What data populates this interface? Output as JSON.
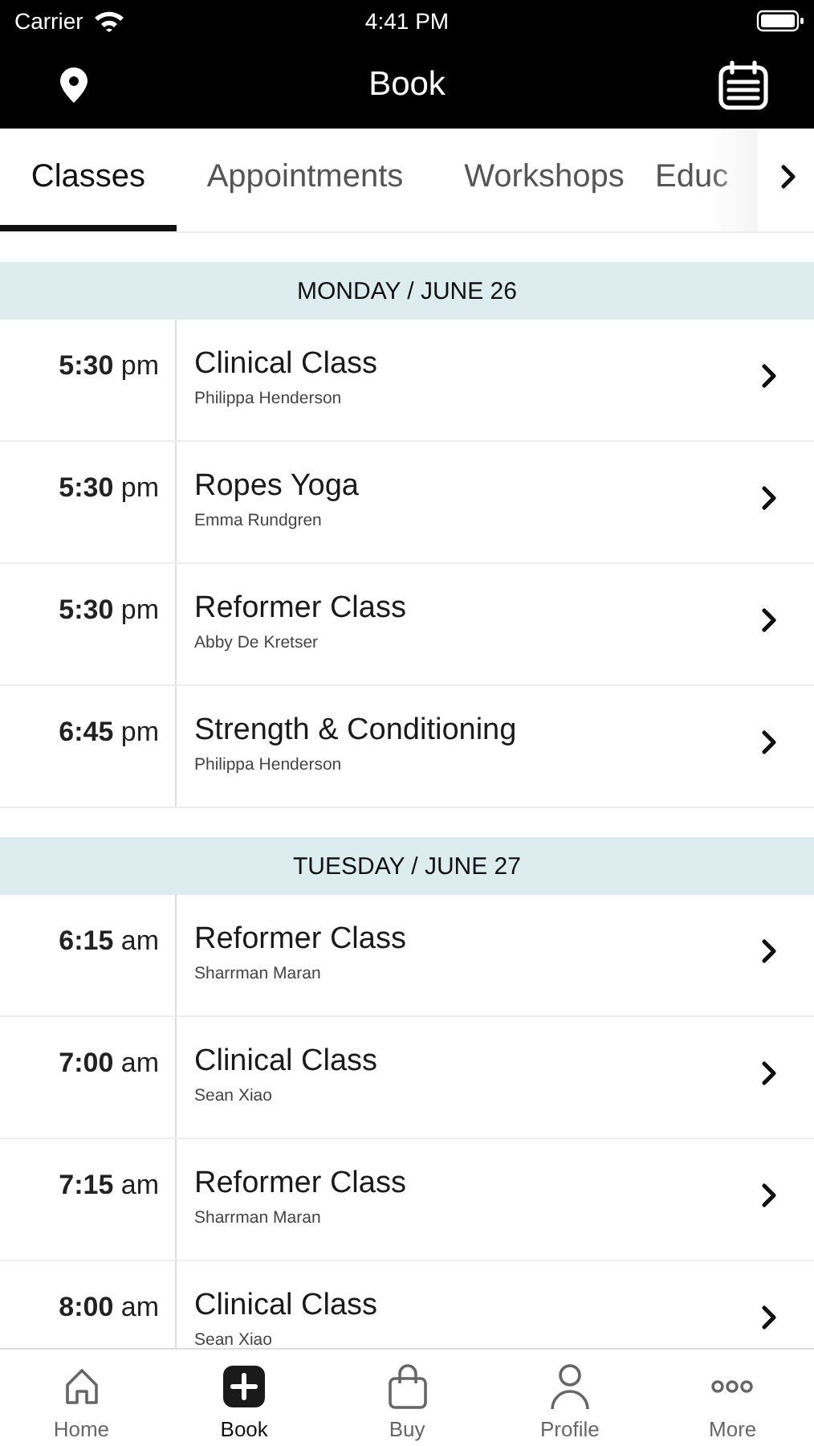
{
  "status_bar": {
    "carrier": "Carrier",
    "time": "4:41 PM"
  },
  "nav_bar": {
    "title": "Book"
  },
  "tabs": [
    {
      "label": "Classes",
      "selected": true
    },
    {
      "label": "Appointments",
      "selected": false
    },
    {
      "label": "Workshops",
      "selected": false
    },
    {
      "label": "Educ",
      "selected": false
    }
  ],
  "days": [
    {
      "header": "MONDAY / JUNE 26",
      "classes": [
        {
          "time": "**5:30** pm",
          "name": "Clinical Class",
          "instructor": "Philippa Henderson"
        },
        {
          "time": "**5:30** pm",
          "name": "Ropes Yoga",
          "instructor": "Emma Rundgren"
        },
        {
          "time": "**5:30** pm",
          "name": "Reformer Class",
          "instructor": "Abby De Kretser"
        },
        {
          "time": "**6:45** pm",
          "name": "Strength & Conditioning",
          "instructor": "Philippa Henderson"
        }
      ]
    },
    {
      "header": "TUESDAY / JUNE 27",
      "classes": [
        {
          "time": "**6:15** am",
          "name": "Reformer Class",
          "instructor": "Sharrman Maran"
        },
        {
          "time": "**7:00** am",
          "name": "Clinical Class",
          "instructor": "Sean Xiao"
        },
        {
          "time": "**7:15** am",
          "name": "Reformer Class",
          "instructor": "Sharrman Maran"
        },
        {
          "time": "**8:00** am",
          "name": "Clinical Class",
          "instructor": "Sean Xiao"
        }
      ]
    }
  ],
  "tab_bar": [
    {
      "label": "Home",
      "selected": false
    },
    {
      "label": "Book",
      "selected": true
    },
    {
      "label": "Buy",
      "selected": false
    },
    {
      "label": "Profile",
      "selected": false
    },
    {
      "label": "More",
      "selected": false
    }
  ]
}
